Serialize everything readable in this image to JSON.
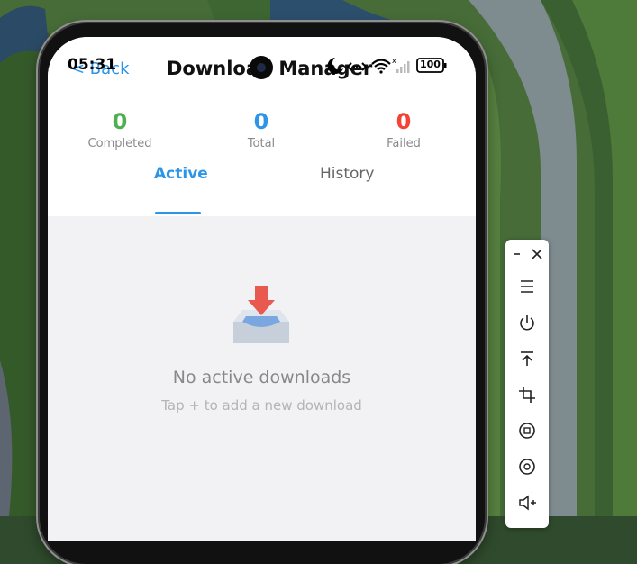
{
  "status_bar": {
    "time": "05:31",
    "battery": "100"
  },
  "header": {
    "back_label": "< Back",
    "title": "Download Manager"
  },
  "stats": [
    {
      "value": "0",
      "label": "Completed",
      "color": "#4caf50"
    },
    {
      "value": "0",
      "label": "Total",
      "color": "#2c95e8"
    },
    {
      "value": "0",
      "label": "Failed",
      "color": "#f44336"
    }
  ],
  "tabs": [
    {
      "label": "Active",
      "active": true
    },
    {
      "label": "History",
      "active": false
    }
  ],
  "empty_state": {
    "title": "No active downloads",
    "subtitle": "Tap + to add a new download",
    "icon": "download-tray-icon"
  },
  "floating_toolbar": {
    "buttons": [
      "minimize-icon",
      "close-icon",
      "menu-icon",
      "power-icon",
      "upload-icon",
      "crop-icon",
      "rotate-icon",
      "screenshot-icon",
      "volume-up-icon"
    ]
  },
  "colors": {
    "accent": "#2c95e8",
    "completed": "#4caf50",
    "failed": "#f44336"
  }
}
